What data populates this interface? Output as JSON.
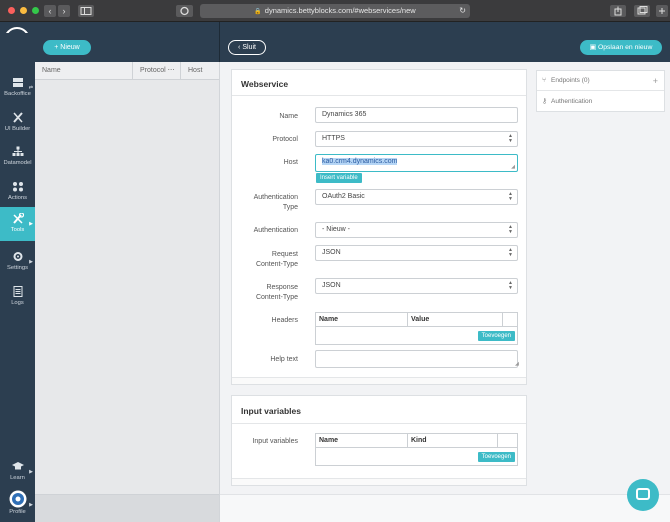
{
  "browser": {
    "url": "dynamics.bettyblocks.com/#webservices/new",
    "back_glyph": "‹",
    "forward_glyph": "›",
    "lock_glyph": "🔒",
    "reload_glyph": "↻"
  },
  "rail": {
    "items": [
      {
        "label": "Backoffice",
        "icon": "backoffice-icon"
      },
      {
        "label": "UI Builder",
        "icon": "ui-builder-icon"
      },
      {
        "label": "Datamodel",
        "icon": "datamodel-icon"
      },
      {
        "label": "Actions",
        "icon": "actions-icon"
      },
      {
        "label": "Tools",
        "icon": "tools-icon"
      },
      {
        "label": "Settings",
        "icon": "settings-icon"
      },
      {
        "label": "Logs",
        "icon": "logs-icon"
      },
      {
        "label": "Learn",
        "icon": "learn-icon"
      },
      {
        "label": "Profile",
        "icon": "profile-icon"
      }
    ],
    "active": "Tools",
    "accent": "#3dbbc7"
  },
  "toolbar": {
    "new_label": "+ Nieuw",
    "close_label": "‹ Sluit",
    "save_label": "Opslaan en nieuw"
  },
  "list": {
    "columns": [
      "Name",
      "Protocol",
      "Host"
    ],
    "sort_glyph": "⋯"
  },
  "webservice": {
    "title": "Webservice",
    "fields": {
      "name": {
        "label": "Name",
        "value": "Dynamics 365"
      },
      "protocol": {
        "label": "Protocol",
        "value": "HTTPS"
      },
      "host": {
        "label": "Host",
        "value": "ka0.crm4.dynamics.com"
      },
      "insert_variable": "Insert variable",
      "auth_type": {
        "label_1": "Authentication",
        "label_2": "Type",
        "value": "OAuth2 Basic"
      },
      "authentication": {
        "label": "Authentication",
        "value": "- Nieuw -"
      },
      "request_content_type": {
        "label_1": "Request",
        "label_2": "Content-Type",
        "value": "JSON"
      },
      "response_content_type": {
        "label_1": "Response",
        "label_2": "Content-Type",
        "value": "JSON"
      },
      "headers": {
        "label": "Headers",
        "columns": [
          "Name",
          "Value"
        ],
        "add_label": "Toevoegen"
      },
      "help_text": {
        "label": "Help text",
        "value": ""
      }
    }
  },
  "input_variables": {
    "title": "Input variables",
    "label": "Input variables",
    "columns": [
      "Name",
      "Kind"
    ],
    "add_label": "Toevoegen"
  },
  "right_panel": {
    "endpoints_label": "Endpoints (0)",
    "endpoints_add": "+",
    "authentication_label": "Authentication"
  }
}
